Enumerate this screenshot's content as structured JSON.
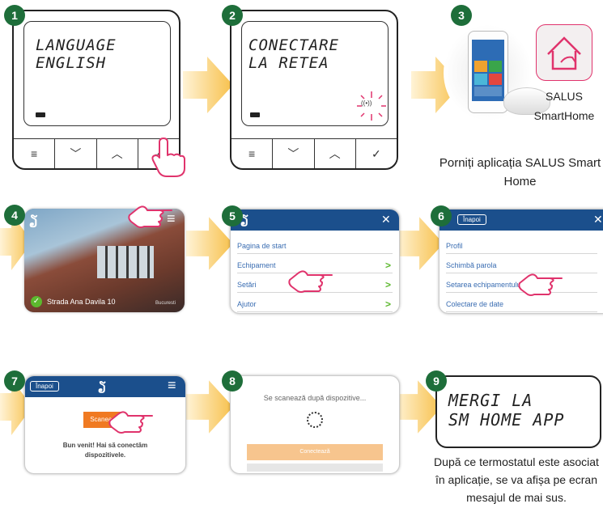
{
  "steps": [
    {
      "n": "1"
    },
    {
      "n": "2"
    },
    {
      "n": "3"
    },
    {
      "n": "4"
    },
    {
      "n": "5"
    },
    {
      "n": "6"
    },
    {
      "n": "7"
    },
    {
      "n": "8"
    },
    {
      "n": "9"
    }
  ],
  "step1": {
    "lcd_line1": "LANGUAGE",
    "lcd_line2": "ENGLISH"
  },
  "step2": {
    "lcd_line1": "CONECTARE",
    "lcd_line2": "LA RETEA",
    "wifi_symbol": "((•))"
  },
  "step3": {
    "app_name_line1": "SALUS",
    "app_name_line2": "SmartHome",
    "caption": "Porniți aplicația SALUS Smart Home"
  },
  "step4": {
    "address": "Strada Ana Davila 10",
    "tag": "Bucuresti"
  },
  "step5": {
    "menu": [
      "Pagina de start",
      "Echipament",
      "Setări",
      "Ajutor"
    ],
    "close": "✕"
  },
  "step6": {
    "back": "Înapoi",
    "menu": [
      "Profil",
      "Schimbă parola",
      "Setarea echipamentului",
      "Colectare de date"
    ],
    "close": "✕"
  },
  "step7": {
    "back": "Înapoi",
    "scan_button": "Scanează",
    "welcome": "Bun venit! Hai să conectăm dispozitivele."
  },
  "step8": {
    "scanning": "Se scanează după dispozitive...",
    "button": "Conectează"
  },
  "step9": {
    "lcd_line1": "MERGI LA",
    "lcd_line2": "SM HOME APP",
    "caption": "După ce termostatul este asociat în aplicație, se va afișa pe ecran mesajul de mai sus."
  },
  "colors": {
    "badge": "#1e6e3a",
    "appbar": "#1b4f8c",
    "accent_orange": "#f07a22",
    "hand_pink": "#e0336c",
    "arrow": "#f7c04a"
  }
}
